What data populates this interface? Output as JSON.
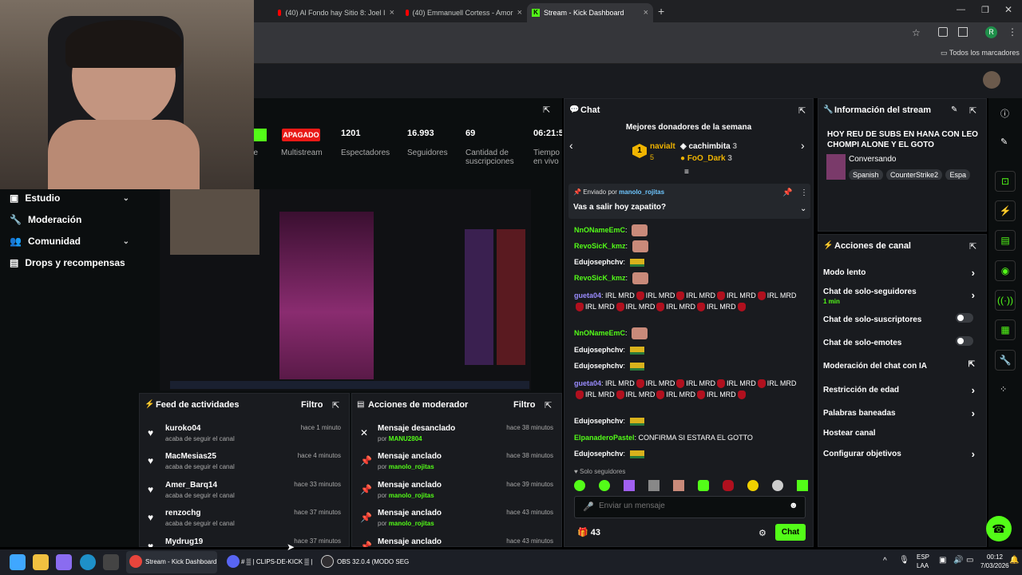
{
  "browser": {
    "tabs": [
      {
        "label": "(40) Al Fondo hay Sitio 8: Joel I",
        "icon": "youtube-icon"
      },
      {
        "label": "(40) Emmanuell Cortess - Amor",
        "icon": "youtube-icon"
      },
      {
        "label": "Stream - Kick Dashboard",
        "icon": "kick-icon"
      }
    ],
    "bookmarks_label": "Todos los marcadores",
    "profile_initial": "R"
  },
  "sidebar": {
    "items": [
      {
        "label": "Estudio"
      },
      {
        "label": "Moderación"
      },
      {
        "label": "Comunidad"
      },
      {
        "label": "Drops y recompensas"
      }
    ]
  },
  "stream_stats": {
    "status_badge": "APAGADO",
    "partial_label": "de",
    "multistream_label": "Multistream",
    "viewers": {
      "value": "1201",
      "label": "Espectadores"
    },
    "followers": {
      "value": "16.993",
      "label": "Seguidores"
    },
    "subs": {
      "value": "69",
      "label": "Cantidad de suscripciones"
    },
    "time": {
      "value": "06:21:5",
      "label": "Tiempo en vivo"
    }
  },
  "activity_feed": {
    "title": "Feed de actividades",
    "filter": "Filtro",
    "items": [
      {
        "name": "kuroko04",
        "sub": "acaba de seguir el canal",
        "time": "hace 1 minuto"
      },
      {
        "name": "MacMesias25",
        "sub": "acaba de seguir el canal",
        "time": "hace 4 minutos"
      },
      {
        "name": "Amer_Barq14",
        "sub": "acaba de seguir el canal",
        "time": "hace 33 minutos"
      },
      {
        "name": "renzochg",
        "sub": "acaba de seguir el canal",
        "time": "hace 37 minutos"
      },
      {
        "name": "Mydrug19",
        "sub": "",
        "time": "hace 37 minutos"
      }
    ]
  },
  "mod_actions": {
    "title": "Acciones de moderador",
    "filter": "Filtro",
    "items": [
      {
        "action": "Mensaje desanclado",
        "by_prefix": "por",
        "by": "MANU2804",
        "time": "hace 38 minutos"
      },
      {
        "action": "Mensaje anclado",
        "by_prefix": "por",
        "by": "manolo_rojitas",
        "time": "hace 38 minutos"
      },
      {
        "action": "Mensaje anclado",
        "by_prefix": "por",
        "by": "manolo_rojitas",
        "time": "hace 39 minutos"
      },
      {
        "action": "Mensaje anclado",
        "by_prefix": "por",
        "by": "manolo_rojitas",
        "time": "hace 43 minutos"
      },
      {
        "action": "Mensaje anclado",
        "by_prefix": "",
        "by": "",
        "time": "hace 43 minutos"
      }
    ]
  },
  "chat": {
    "title": "Chat",
    "donors_title": "Mejores donadores de la semana",
    "donors": [
      {
        "rank": "1",
        "name": "navialt",
        "amount": "5"
      },
      {
        "name": "cachimbita",
        "amount": "3"
      },
      {
        "name": "FoO_Dark",
        "amount": "3"
      }
    ],
    "pinned": {
      "prefix": "Enviado por",
      "user": "manolo_rojitas",
      "message": "Vas a salir hoy zapatito?"
    },
    "messages": [
      {
        "user": "NnONameEmC",
        "color": "#53fc18",
        "text": "",
        "emote": "face"
      },
      {
        "user": "RevoSicK_kmz",
        "color": "#53fc18",
        "text": "",
        "emote": "face"
      },
      {
        "user": "Edujosephchv",
        "color": "#ffffff",
        "text": "",
        "emote": "truck"
      },
      {
        "user": "RevoSicK_kmz",
        "color": "#53fc18",
        "text": "",
        "emote": "face"
      },
      {
        "user": "gueta04",
        "color": "#9a8cff",
        "text": "IRL MRD",
        "emote": "irl"
      },
      {
        "user": "NnONameEmC",
        "color": "#53fc18",
        "text": "",
        "emote": "face"
      },
      {
        "user": "Edujosephchv",
        "color": "#ffffff",
        "text": "",
        "emote": "truck"
      },
      {
        "user": "Edujosephchv",
        "color": "#ffffff",
        "text": "",
        "emote": "truck"
      },
      {
        "user": "gueta04",
        "color": "#9a8cff",
        "text": "IRL MRD",
        "emote": "irl"
      },
      {
        "user": "Edujosephchv",
        "color": "#ffffff",
        "text": "",
        "emote": "truck"
      },
      {
        "user": "ElpanaderoPastel",
        "color": "#53fc18",
        "text": "CONFIRMA SI ESTARA EL GOTTO",
        "emote": ""
      },
      {
        "user": "Edujosephchv",
        "color": "#ffffff",
        "text": "",
        "emote": "truck"
      }
    ],
    "followers_only": "Solo seguidores",
    "input_placeholder": "Enviar un mensaje",
    "points": "43",
    "send_label": "Chat"
  },
  "stream_info": {
    "title": "Información del stream",
    "stream_title": "HOY REU DE SUBS EN HANA CON LEO CHOMPI ALONE Y EL GOTO",
    "category": "Conversando",
    "tags": [
      "Spanish",
      "CounterStrike2",
      "Espa"
    ]
  },
  "channel_actions": {
    "title": "Acciones de canal",
    "items": [
      {
        "label": "Modo lento",
        "control": "chevron"
      },
      {
        "label": "Chat de solo-seguidores",
        "sub": "1 min",
        "control": "chevron"
      },
      {
        "label": "Chat de solo-suscriptores",
        "control": "toggle"
      },
      {
        "label": "Chat de solo-emotes",
        "control": "toggle"
      },
      {
        "label": "Moderación del chat con IA",
        "control": "external"
      },
      {
        "label": "Restricción de edad",
        "control": "chevron"
      },
      {
        "label": "Palabras baneadas",
        "control": "chevron"
      },
      {
        "label": "Hostear canal",
        "control": "none"
      },
      {
        "label": "Configurar objetivos",
        "control": "chevron"
      }
    ]
  },
  "taskbar": {
    "chrome_label": "Stream - Kick Dashboard",
    "discord_label": "# ▒ | CLIPS-DE-KICK ▒ |",
    "obs_label": "OBS 32.0.4 (MODO SEG",
    "lang": "ESP",
    "lang2": "LAA",
    "time": "00:12",
    "date": "7/03/2026"
  },
  "colors": {
    "kick_green": "#53fc18",
    "live_red": "#e91916",
    "panel": "#191b1f"
  }
}
